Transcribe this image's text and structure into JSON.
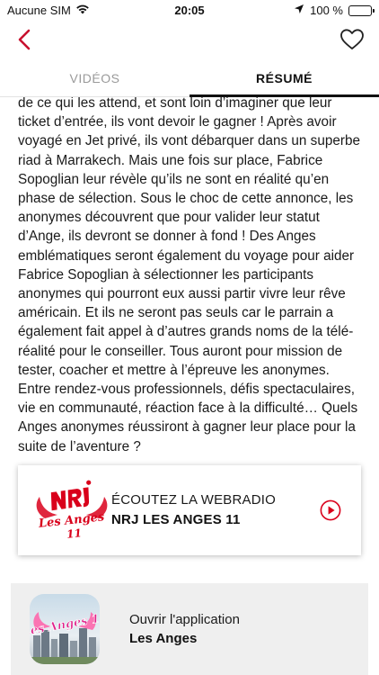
{
  "status_bar": {
    "carrier": "Aucune SIM",
    "time": "20:05",
    "battery": "100 %",
    "battery_level": 1.0,
    "icons": [
      "wifi-icon",
      "location-arrow-icon",
      "battery-icon"
    ]
  },
  "nav": {
    "back_icon": "chevron-left-icon",
    "favorite_icon": "heart-outline-icon",
    "accent_color": "#c8102e"
  },
  "tabs": [
    {
      "label": "VIDÉOS",
      "active": false
    },
    {
      "label": "RÉSUMÉ",
      "active": true
    }
  ],
  "summary": {
    "text": "de ce qui les attend, et sont loin d’imaginer que leur ticket d’entrée, ils vont devoir le gagner ! Après avoir voyagé en Jet privé, ils vont débarquer dans un superbe riad à Marrakech. Mais une fois sur place, Fabrice Sopoglian leur révèle qu’ils ne sont en réalité qu’en phase de sélection. Sous le choc de cette annonce, les anonymes découvrent que pour valider leur statut d’Ange, ils devront se donner à fond ! Des Anges emblématiques seront également du voyage pour aider Fabrice Sopoglian à sélectionner les participants anonymes qui pourront eux aussi partir vivre leur rêve américain. Et ils ne seront pas seuls car le parrain a également fait appel à d’autres grands noms de la télé-réalité pour le conseiller. Tous auront pour mission de tester, coacher et mettre à l’épreuve les anonymes. Entre rendez-vous professionnels, défis spectaculaires, vie en communauté, réaction face à la difficulté… Quels Anges anonymes réussiront à gagner leur place pour la suite de l’aventure ?"
  },
  "radio_card": {
    "logo": {
      "brand": "NRJ",
      "subtitle": "Les Anges",
      "number": "11"
    },
    "kicker": "ÉCOUTEZ LA WEBRADIO",
    "name": "NRJ LES ANGES 11",
    "play_icon": "play-circle-icon",
    "brand_color": "#d9001b"
  },
  "app_card": {
    "icon_text": "Les Anges 11",
    "open_label": "Ouvrir l'application",
    "app_name": "Les Anges",
    "card_color": "#efefef"
  }
}
